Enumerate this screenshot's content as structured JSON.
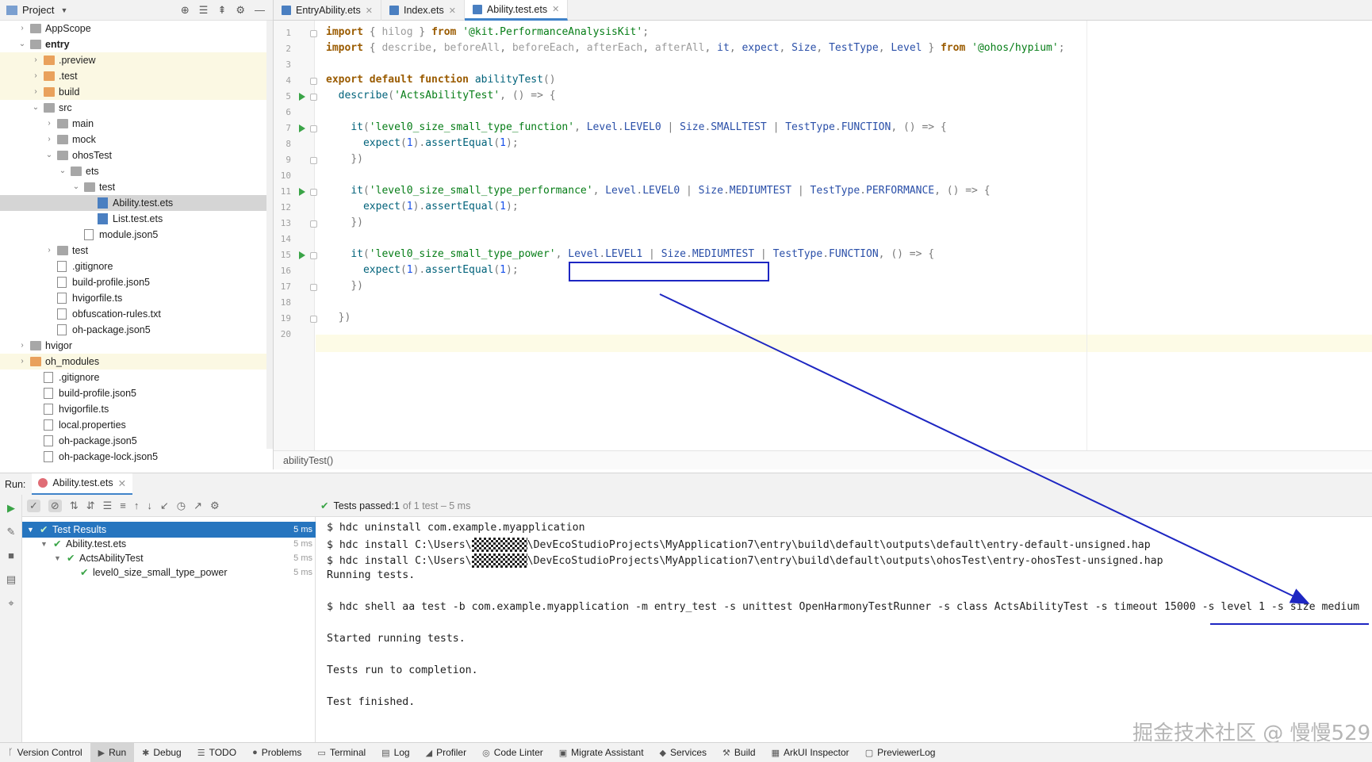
{
  "project_panel": {
    "title": "Project",
    "tree": [
      {
        "label": "AppScope",
        "depth": 0,
        "kind": "folder",
        "arrow": "›"
      },
      {
        "label": "entry",
        "depth": 0,
        "kind": "folder",
        "arrow": "⌄",
        "bold": true
      },
      {
        "label": ".preview",
        "depth": 1,
        "kind": "folder-orange",
        "arrow": "›",
        "hl": true
      },
      {
        "label": ".test",
        "depth": 1,
        "kind": "folder-orange",
        "arrow": "›",
        "hl": true
      },
      {
        "label": "build",
        "depth": 1,
        "kind": "folder-orange",
        "arrow": "›",
        "hl": true
      },
      {
        "label": "src",
        "depth": 1,
        "kind": "folder",
        "arrow": "⌄"
      },
      {
        "label": "main",
        "depth": 2,
        "kind": "folder",
        "arrow": "›"
      },
      {
        "label": "mock",
        "depth": 2,
        "kind": "folder",
        "arrow": "›"
      },
      {
        "label": "ohosTest",
        "depth": 2,
        "kind": "folder",
        "arrow": "⌄"
      },
      {
        "label": "ets",
        "depth": 3,
        "kind": "folder",
        "arrow": "⌄"
      },
      {
        "label": "test",
        "depth": 4,
        "kind": "folder",
        "arrow": "⌄"
      },
      {
        "label": "Ability.test.ets",
        "depth": 5,
        "kind": "ets",
        "arrow": "",
        "sel": true
      },
      {
        "label": "List.test.ets",
        "depth": 5,
        "kind": "ets",
        "arrow": ""
      },
      {
        "label": "module.json5",
        "depth": 4,
        "kind": "file",
        "arrow": ""
      },
      {
        "label": "test",
        "depth": 2,
        "kind": "folder",
        "arrow": "›"
      },
      {
        "label": ".gitignore",
        "depth": 2,
        "kind": "file",
        "arrow": ""
      },
      {
        "label": "build-profile.json5",
        "depth": 2,
        "kind": "file",
        "arrow": ""
      },
      {
        "label": "hvigorfile.ts",
        "depth": 2,
        "kind": "file",
        "arrow": ""
      },
      {
        "label": "obfuscation-rules.txt",
        "depth": 2,
        "kind": "file",
        "arrow": ""
      },
      {
        "label": "oh-package.json5",
        "depth": 2,
        "kind": "file",
        "arrow": ""
      },
      {
        "label": "hvigor",
        "depth": 0,
        "kind": "folder",
        "arrow": "›"
      },
      {
        "label": "oh_modules",
        "depth": 0,
        "kind": "folder-orange",
        "arrow": "›",
        "hl": true
      },
      {
        "label": ".gitignore",
        "depth": 1,
        "kind": "file",
        "arrow": ""
      },
      {
        "label": "build-profile.json5",
        "depth": 1,
        "kind": "file",
        "arrow": ""
      },
      {
        "label": "hvigorfile.ts",
        "depth": 1,
        "kind": "file",
        "arrow": ""
      },
      {
        "label": "local.properties",
        "depth": 1,
        "kind": "file",
        "arrow": ""
      },
      {
        "label": "oh-package.json5",
        "depth": 1,
        "kind": "file",
        "arrow": ""
      },
      {
        "label": "oh-package-lock.json5",
        "depth": 1,
        "kind": "file",
        "arrow": ""
      }
    ]
  },
  "editor_tabs": [
    {
      "label": "EntryAbility.ets",
      "active": false
    },
    {
      "label": "Index.ets",
      "active": false
    },
    {
      "label": "Ability.test.ets",
      "active": true
    }
  ],
  "code_lines": [
    [
      [
        "kw",
        "import"
      ],
      [
        "p",
        " { "
      ],
      [
        "c",
        "hilog"
      ],
      [
        "p",
        " } "
      ],
      [
        "kw",
        "from"
      ],
      [
        "s",
        " '@kit.PerformanceAnalysisKit'"
      ],
      [
        "p",
        ";"
      ]
    ],
    [
      [
        "kw",
        "import"
      ],
      [
        "p",
        " { "
      ],
      [
        "c",
        "describe"
      ],
      [
        "p",
        ", "
      ],
      [
        "c",
        "beforeAll"
      ],
      [
        "p",
        ", "
      ],
      [
        "c",
        "beforeEach"
      ],
      [
        "p",
        ", "
      ],
      [
        "c",
        "afterEach"
      ],
      [
        "p",
        ", "
      ],
      [
        "c",
        "afterAll"
      ],
      [
        "p",
        ", "
      ],
      [
        "id",
        "it"
      ],
      [
        "p",
        ", "
      ],
      [
        "id",
        "expect"
      ],
      [
        "p",
        ", "
      ],
      [
        "id",
        "Size"
      ],
      [
        "p",
        ", "
      ],
      [
        "id",
        "TestType"
      ],
      [
        "p",
        ", "
      ],
      [
        "id",
        "Level"
      ],
      [
        "p",
        " } "
      ],
      [
        "kw",
        "from"
      ],
      [
        "s",
        " '@ohos/hypium'"
      ],
      [
        "p",
        ";"
      ]
    ],
    [],
    [
      [
        "kw",
        "export default function "
      ],
      [
        "fn",
        "abilityTest"
      ],
      [
        "p",
        "()"
      ]
    ],
    [
      [
        "t",
        "  "
      ],
      [
        "fn",
        "describe"
      ],
      [
        "p",
        "("
      ],
      [
        "s",
        "'ActsAbilityTest'"
      ],
      [
        "p",
        ", () => {"
      ]
    ],
    [],
    [
      [
        "t",
        "    "
      ],
      [
        "fn",
        "it"
      ],
      [
        "p",
        "("
      ],
      [
        "s",
        "'level0_size_small_type_function'"
      ],
      [
        "p",
        ", "
      ],
      [
        "id",
        "Level"
      ],
      [
        "p",
        "."
      ],
      [
        "id",
        "LEVEL0"
      ],
      [
        "p",
        " | "
      ],
      [
        "id",
        "Size"
      ],
      [
        "p",
        "."
      ],
      [
        "id",
        "SMALLTEST"
      ],
      [
        "p",
        " | "
      ],
      [
        "id",
        "TestType"
      ],
      [
        "p",
        "."
      ],
      [
        "id",
        "FUNCTION"
      ],
      [
        "p",
        ", () => {"
      ]
    ],
    [
      [
        "t",
        "      "
      ],
      [
        "fn",
        "expect"
      ],
      [
        "p",
        "("
      ],
      [
        "n",
        "1"
      ],
      [
        "p",
        ")."
      ],
      [
        "fn",
        "assertEqual"
      ],
      [
        "p",
        "("
      ],
      [
        "n",
        "1"
      ],
      [
        "p",
        ");"
      ]
    ],
    [
      [
        "t",
        "    "
      ],
      [
        "p",
        "})"
      ]
    ],
    [],
    [
      [
        "t",
        "    "
      ],
      [
        "fn",
        "it"
      ],
      [
        "p",
        "("
      ],
      [
        "s",
        "'level0_size_small_type_performance'"
      ],
      [
        "p",
        ", "
      ],
      [
        "id",
        "Level"
      ],
      [
        "p",
        "."
      ],
      [
        "id",
        "LEVEL0"
      ],
      [
        "p",
        " | "
      ],
      [
        "id",
        "Size"
      ],
      [
        "p",
        "."
      ],
      [
        "id",
        "MEDIUMTEST"
      ],
      [
        "p",
        " | "
      ],
      [
        "id",
        "TestType"
      ],
      [
        "p",
        "."
      ],
      [
        "id",
        "PERFORMANCE"
      ],
      [
        "p",
        ", () => {"
      ]
    ],
    [
      [
        "t",
        "      "
      ],
      [
        "fn",
        "expect"
      ],
      [
        "p",
        "("
      ],
      [
        "n",
        "1"
      ],
      [
        "p",
        ")."
      ],
      [
        "fn",
        "assertEqual"
      ],
      [
        "p",
        "("
      ],
      [
        "n",
        "1"
      ],
      [
        "p",
        ");"
      ]
    ],
    [
      [
        "t",
        "    "
      ],
      [
        "p",
        "})"
      ]
    ],
    [],
    [
      [
        "t",
        "    "
      ],
      [
        "fn",
        "it"
      ],
      [
        "p",
        "("
      ],
      [
        "s",
        "'level0_size_small_type_power'"
      ],
      [
        "p",
        ", "
      ],
      [
        "id",
        "Level"
      ],
      [
        "p",
        "."
      ],
      [
        "id",
        "LEVEL1"
      ],
      [
        "p",
        " | "
      ],
      [
        "id",
        "Size"
      ],
      [
        "p",
        "."
      ],
      [
        "id",
        "MEDIUMTEST"
      ],
      [
        "p",
        " | "
      ],
      [
        "id",
        "TestType"
      ],
      [
        "p",
        "."
      ],
      [
        "id",
        "FUNCTION"
      ],
      [
        "p",
        ", () => {"
      ]
    ],
    [
      [
        "t",
        "      "
      ],
      [
        "fn",
        "expect"
      ],
      [
        "p",
        "("
      ],
      [
        "n",
        "1"
      ],
      [
        "p",
        ")."
      ],
      [
        "fn",
        "assertEqual"
      ],
      [
        "p",
        "("
      ],
      [
        "n",
        "1"
      ],
      [
        "p",
        ");"
      ]
    ],
    [
      [
        "t",
        "    "
      ],
      [
        "p",
        "})"
      ]
    ],
    [],
    [
      [
        "t",
        "  "
      ],
      [
        "p",
        "})"
      ]
    ],
    []
  ],
  "run_markers": [
    5,
    7,
    11,
    15
  ],
  "breadcrumb": "abilityTest()",
  "run_panel": {
    "label": "Run:",
    "tab": "Ability.test.ets",
    "status_prefix": "Tests passed: ",
    "status_count": "1",
    "status_suffix": " of 1 test – 5 ms",
    "tree": [
      {
        "label": "Test Results",
        "depth": 0,
        "time": "5 ms",
        "sel": true,
        "arrow": "⌄"
      },
      {
        "label": "Ability.test.ets",
        "depth": 1,
        "time": "5 ms",
        "arrow": "⌄"
      },
      {
        "label": "ActsAbilityTest",
        "depth": 2,
        "time": "5 ms",
        "arrow": "⌄"
      },
      {
        "label": "level0_size_small_type_power",
        "depth": 3,
        "time": "5 ms",
        "arrow": ""
      }
    ],
    "console": [
      {
        "text": "$ hdc uninstall com.example.myapplication"
      },
      {
        "pre": "$ hdc install C:\\Users\\",
        "post": "\\DevEcoStudioProjects\\MyApplication7\\entry\\build\\default\\outputs\\default\\entry-default-unsigned.hap"
      },
      {
        "pre": "$ hdc install C:\\Users\\",
        "post": "\\DevEcoStudioProjects\\MyApplication7\\entry\\build\\default\\outputs\\ohosTest\\entry-ohosTest-unsigned.hap"
      },
      {
        "text": "Running tests."
      },
      {
        "text": ""
      },
      {
        "text": "$ hdc shell aa test -b com.example.myapplication -m entry_test -s unittest OpenHarmonyTestRunner -s class ActsAbilityTest -s timeout 15000 -s level 1 -s size medium"
      },
      {
        "text": ""
      },
      {
        "text": "Started running tests."
      },
      {
        "text": ""
      },
      {
        "text": "Tests run to completion."
      },
      {
        "text": ""
      },
      {
        "text": "Test finished."
      }
    ]
  },
  "statusbar": [
    {
      "label": "Version Control",
      "icon": "ᚴ"
    },
    {
      "label": "Run",
      "icon": "▶",
      "active": true
    },
    {
      "label": "Debug",
      "icon": "✱"
    },
    {
      "label": "TODO",
      "icon": "☰"
    },
    {
      "label": "Problems",
      "icon": "●"
    },
    {
      "label": "Terminal",
      "icon": "▭"
    },
    {
      "label": "Log",
      "icon": "▤"
    },
    {
      "label": "Profiler",
      "icon": "◢"
    },
    {
      "label": "Code Linter",
      "icon": "◎"
    },
    {
      "label": "Migrate Assistant",
      "icon": "▣"
    },
    {
      "label": "Services",
      "icon": "◆"
    },
    {
      "label": "Build",
      "icon": "⚒"
    },
    {
      "label": "ArkUI Inspector",
      "icon": "▦"
    },
    {
      "label": "PreviewerLog",
      "icon": "▢"
    }
  ],
  "watermark": "掘金技术社区 @ 慢慢529",
  "colors": {
    "accent": "#4083c9",
    "annotation": "#1d26c2",
    "pass": "#3aa447"
  }
}
